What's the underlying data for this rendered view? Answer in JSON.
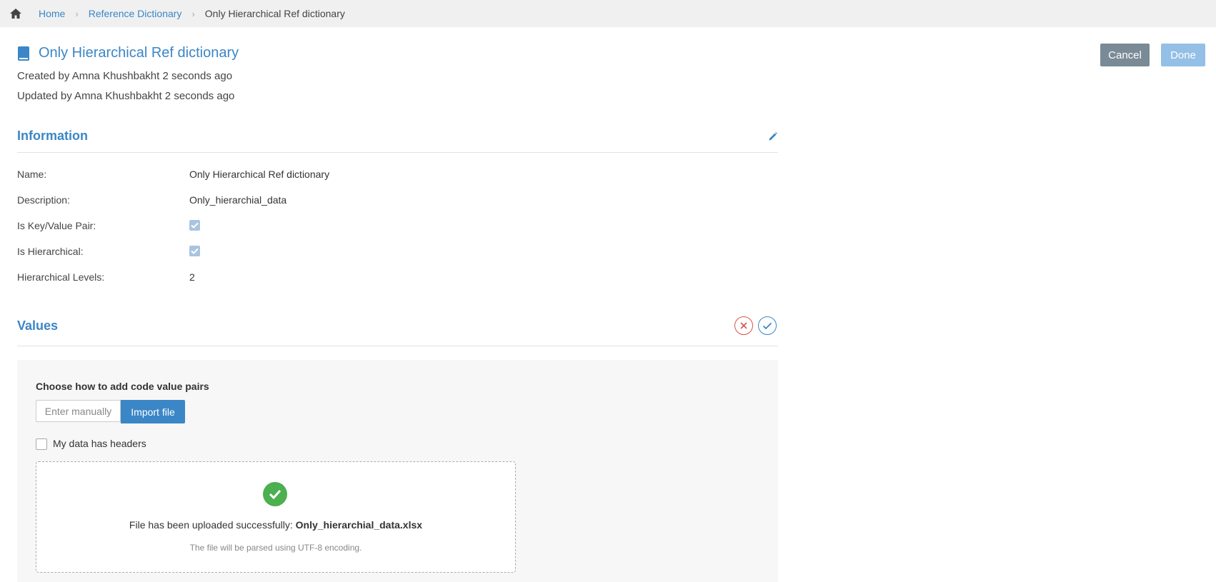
{
  "breadcrumb": {
    "home": "Home",
    "items": [
      "Reference Dictionary"
    ],
    "current": "Only Hierarchical Ref dictionary",
    "separator": "›"
  },
  "header": {
    "title": "Only Hierarchical Ref dictionary",
    "created": "Created by Amna Khushbakht 2 seconds ago",
    "updated": "Updated by Amna Khushbakht 2 seconds ago",
    "cancel_label": "Cancel",
    "done_label": "Done"
  },
  "information": {
    "title": "Information",
    "fields": [
      {
        "label": "Name:",
        "value": "Only Hierarchical Ref dictionary"
      },
      {
        "label": "Description:",
        "value": "Only_hierarchial_data"
      },
      {
        "label": "Is Key/Value Pair:",
        "checked": true
      },
      {
        "label": "Is Hierarchical:",
        "checked": true
      },
      {
        "label": "Hierarchical Levels:",
        "value": "2"
      }
    ]
  },
  "values": {
    "title": "Values",
    "choose_label": "Choose how to add code value pairs",
    "enter_manually_label": "Enter manually",
    "import_file_label": "Import file",
    "headers_label": "My data has headers",
    "headers_checked": false,
    "upload_message": "File has been uploaded successfully:",
    "file_name": "Only_hierarchial_data.xlsx",
    "encoding_note": "The file will be parsed using UTF-8 encoding."
  },
  "colors": {
    "accent": "#3b86c6",
    "success": "#4caf50",
    "danger": "#d9534f",
    "cancel_bg": "#7a8a96",
    "done_bg": "#94bfe6"
  },
  "icons": [
    "home-icon",
    "book-icon",
    "pencil-icon",
    "close-icon",
    "check-icon",
    "success-check-icon"
  ]
}
